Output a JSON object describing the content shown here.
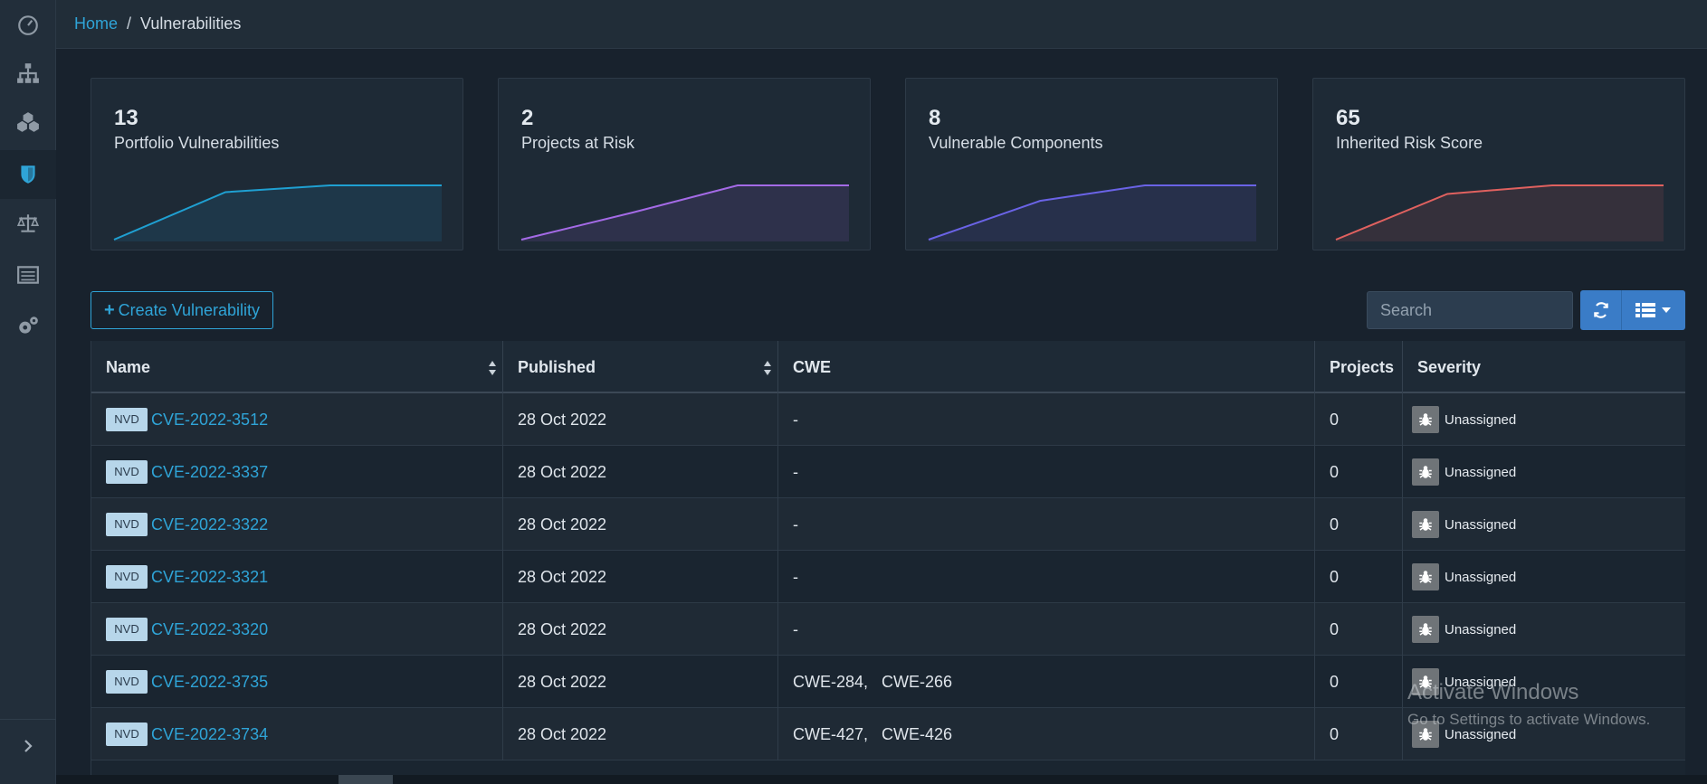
{
  "breadcrumb": {
    "home": "Home",
    "separator": "/",
    "current": "Vulnerabilities"
  },
  "sidebar": {
    "items": [
      {
        "icon": "dashboard-icon",
        "active": false
      },
      {
        "icon": "projects-hierarchy-icon",
        "active": false
      },
      {
        "icon": "components-cubes-icon",
        "active": false
      },
      {
        "icon": "vulnerabilities-shield-icon",
        "active": true
      },
      {
        "icon": "licenses-scale-icon",
        "active": false
      },
      {
        "icon": "policy-list-icon",
        "active": false
      },
      {
        "icon": "administration-gears-icon",
        "active": false
      }
    ],
    "toggle_icon": "chevron-right-icon"
  },
  "cards": [
    {
      "value": "13",
      "label": "Portfolio Vulnerabilities",
      "color": "#1fa0d2",
      "trend": [
        0,
        7,
        8,
        8
      ]
    },
    {
      "value": "2",
      "label": "Projects at Risk",
      "color": "#a46ae6",
      "trend": [
        0,
        1,
        2,
        2
      ]
    },
    {
      "value": "8",
      "label": "Vulnerable Components",
      "color": "#6a63e6",
      "trend": [
        0,
        5,
        7,
        7
      ]
    },
    {
      "value": "65",
      "label": "Inherited Risk Score",
      "color": "#e0615f",
      "trend": [
        0,
        48,
        57,
        57
      ]
    }
  ],
  "toolbar": {
    "create_label": "Create Vulnerability",
    "search_placeholder": "Search"
  },
  "table": {
    "columns": [
      "Name",
      "Published",
      "CWE",
      "Projects",
      "Severity"
    ],
    "rows": [
      {
        "source": "NVD",
        "name": "CVE-2022-3512",
        "published": "28 Oct 2022",
        "cwe": "-",
        "projects": "0",
        "severity": "Unassigned"
      },
      {
        "source": "NVD",
        "name": "CVE-2022-3337",
        "published": "28 Oct 2022",
        "cwe": "-",
        "projects": "0",
        "severity": "Unassigned"
      },
      {
        "source": "NVD",
        "name": "CVE-2022-3322",
        "published": "28 Oct 2022",
        "cwe": "-",
        "projects": "0",
        "severity": "Unassigned"
      },
      {
        "source": "NVD",
        "name": "CVE-2022-3321",
        "published": "28 Oct 2022",
        "cwe": "-",
        "projects": "0",
        "severity": "Unassigned"
      },
      {
        "source": "NVD",
        "name": "CVE-2022-3320",
        "published": "28 Oct 2022",
        "cwe": "-",
        "projects": "0",
        "severity": "Unassigned"
      },
      {
        "source": "NVD",
        "name": "CVE-2022-3735",
        "published": "28 Oct 2022",
        "cwe": "CWE-284,   CWE-266",
        "projects": "0",
        "severity": "Unassigned"
      },
      {
        "source": "NVD",
        "name": "CVE-2022-3734",
        "published": "28 Oct 2022",
        "cwe": "CWE-427,   CWE-426",
        "projects": "0",
        "severity": "Unassigned"
      }
    ]
  },
  "watermark": {
    "title": "Activate Windows",
    "subtitle": "Go to Settings to activate Windows."
  }
}
